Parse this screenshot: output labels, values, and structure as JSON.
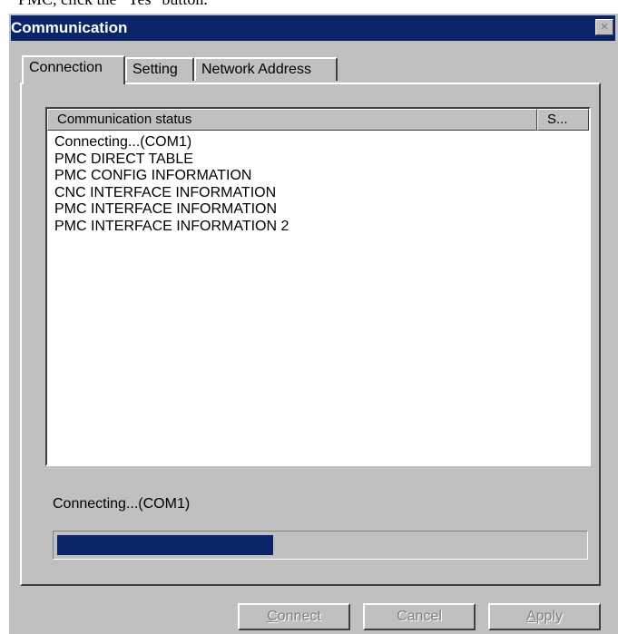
{
  "header_text": "PMC, click the \"Yes\" button.",
  "dialog": {
    "title": "Communication",
    "close_glyph": "×"
  },
  "tabs": [
    {
      "label": "Connection",
      "active": true
    },
    {
      "label": "Setting",
      "active": false
    },
    {
      "label": "Network Address",
      "active": false
    }
  ],
  "list": {
    "columns": [
      "Communication status",
      "S..."
    ],
    "rows": [
      "Connecting...(COM1)",
      "PMC DIRECT TABLE",
      "PMC CONFIG INFORMATION",
      "CNC INTERFACE INFORMATION",
      "PMC INTERFACE INFORMATION",
      "PMC INTERFACE INFORMATION 2"
    ]
  },
  "status_text": "Connecting...(COM1)",
  "progress": {
    "fraction": 0.41,
    "color": "#0a246a"
  },
  "buttons": {
    "connect": {
      "label": "Connect",
      "mnemonic": "C",
      "rest": "onnect",
      "enabled": false
    },
    "cancel": {
      "label": "Cancel",
      "enabled": false
    },
    "apply": {
      "label": "Apply",
      "mnemonic": "A",
      "rest": "pply",
      "enabled": false
    }
  },
  "colors": {
    "titlebar": "#0a246a",
    "face": "#c0c0c0",
    "disabled_text": "#808080"
  }
}
